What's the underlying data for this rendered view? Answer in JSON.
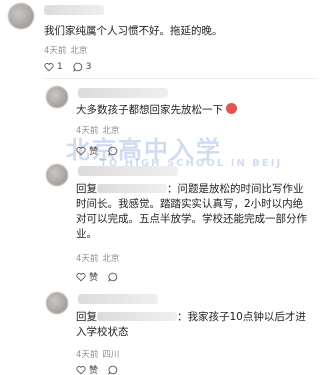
{
  "comments": [
    {
      "text": "我们家纯属个人习惯不好。拖延的晚。",
      "time": "4天前",
      "location": "北京",
      "likes": "1",
      "replies": "3"
    },
    {
      "text": "大多数孩子都想回家先放松一下",
      "time": "4天前",
      "location": "北京",
      "like_label": "赞",
      "has_emoji": true
    },
    {
      "reply_prefix": "回复",
      "text": "：问题是放松的时间比写作业时间长。我感觉。踏踏实实认真写，2小时以内绝对可以完成。五点半放学。学校还能完成一部分作业。",
      "time": "4天前",
      "location": "北京",
      "like_label": "赞"
    },
    {
      "reply_prefix": "回复",
      "text": "：我家孩子10点钟以后才进入学校状态",
      "time": "4天前",
      "location": "四川",
      "like_label": "赞"
    }
  ],
  "watermark": {
    "cn": "北京高中入学",
    "en": "TO HIGH SCHOOL IN BEIJ"
  },
  "icons": [
    "heart-icon",
    "comment-icon",
    "like-icon",
    "reply-icon"
  ]
}
